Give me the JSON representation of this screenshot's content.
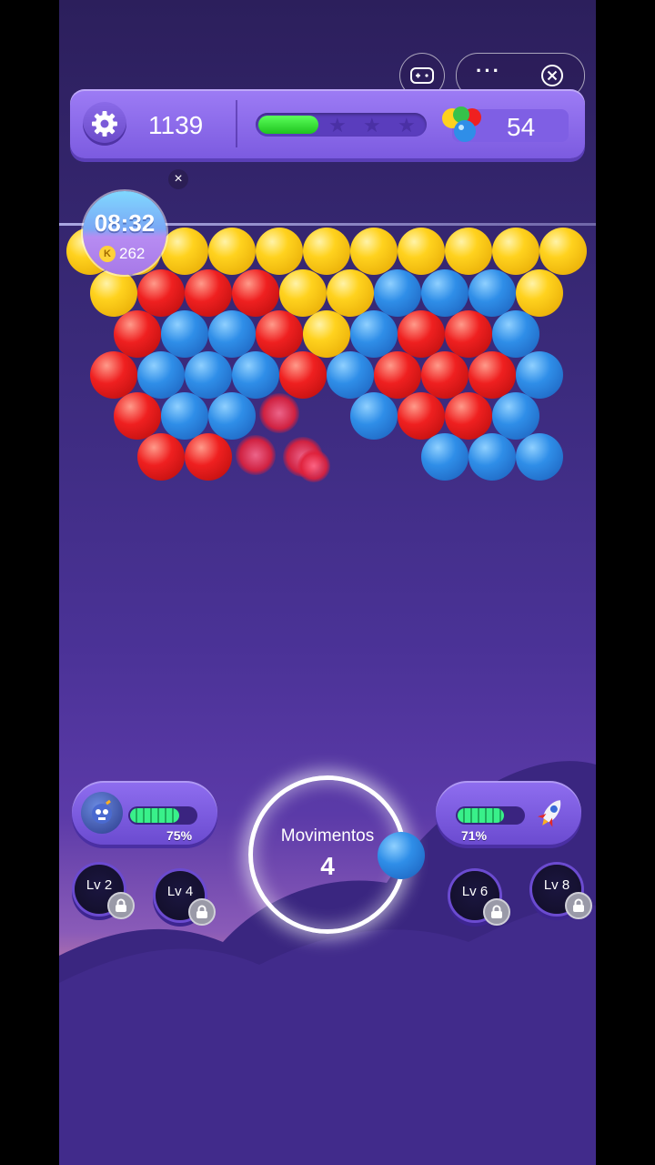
{
  "top_bar": {
    "score": "1139",
    "progress_fraction": 0.36,
    "stars_total": 3,
    "ball_count": "54"
  },
  "timer": {
    "time": "08:32",
    "coin_letter": "K",
    "coins": "262"
  },
  "shooter": {
    "moves_label": "Movimentos",
    "moves_count": "4",
    "next_bubble_color": "blue"
  },
  "boosters": {
    "left": {
      "percent_label": "75%",
      "fill": 0.75,
      "icon": "bomb-icon"
    },
    "right": {
      "percent_label": "71%",
      "fill": 0.71,
      "icon": "rocket-icon"
    }
  },
  "level_buttons": [
    {
      "label": "Lv 2",
      "locked": true
    },
    {
      "label": "Lv 4",
      "locked": true
    },
    {
      "label": "Lv 6",
      "locked": true
    },
    {
      "label": "Lv 8",
      "locked": true
    }
  ],
  "colors": {
    "yellow": "#ffd21e",
    "red": "#ef2020",
    "blue": "#2f8ee8",
    "accent": "#8a6ae8"
  },
  "bubble_rows": [
    "YYYYYYYYYYY",
    "YRRRYYBBBY",
    "RBBRYBRRB",
    "RBBBRBRRRB",
    "RBB  BRRB",
    "RR    BBB"
  ]
}
